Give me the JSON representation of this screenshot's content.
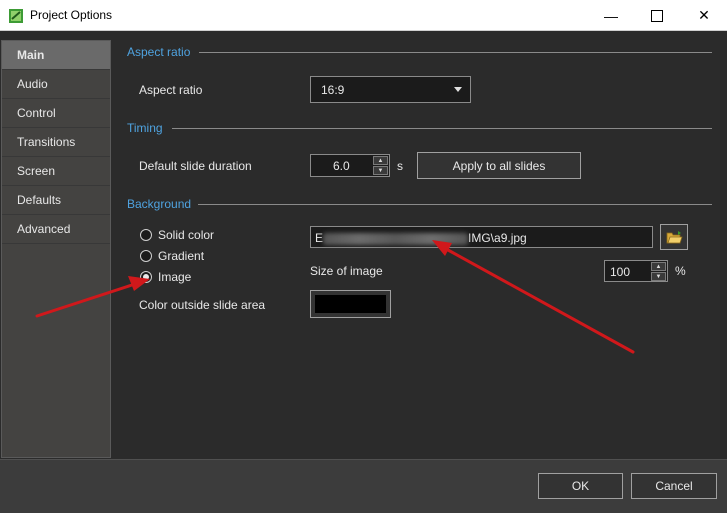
{
  "window": {
    "title": "Project Options"
  },
  "sidebar": {
    "items": [
      {
        "label": "Main",
        "active": true
      },
      {
        "label": "Audio"
      },
      {
        "label": "Control"
      },
      {
        "label": "Transitions"
      },
      {
        "label": "Screen"
      },
      {
        "label": "Defaults"
      },
      {
        "label": "Advanced"
      }
    ]
  },
  "aspect": {
    "section": "Aspect ratio",
    "label": "Aspect ratio",
    "value": "16:9"
  },
  "timing": {
    "section": "Timing",
    "label": "Default slide duration",
    "value": "6.0",
    "unit": "s",
    "apply_label": "Apply to all slides"
  },
  "background": {
    "section": "Background",
    "options": [
      "Solid color",
      "Gradient",
      "Image"
    ],
    "selected": "Image",
    "path_prefix": "E",
    "path_suffix": "IMG\\a9.jpg",
    "size_label": "Size of image",
    "size_value": "100",
    "size_unit": "%",
    "outside_label": "Color outside slide area",
    "outside_color": "#000000"
  },
  "footer": {
    "ok": "OK",
    "cancel": "Cancel"
  },
  "colors": {
    "accent": "#4fa3e0",
    "arrow": "#d0181b"
  }
}
